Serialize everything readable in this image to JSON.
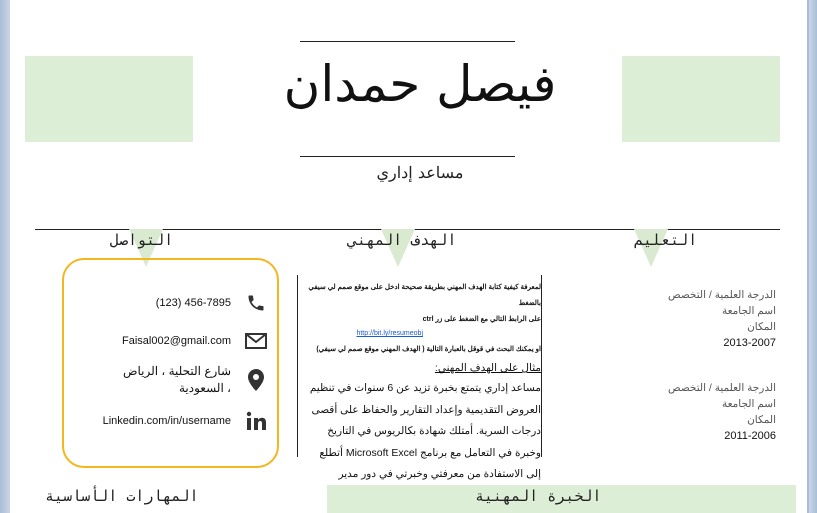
{
  "resume": {
    "name": "فيصل حمدان",
    "job_title": "مساعد إداري",
    "sections": {
      "contact": "التواصل",
      "objective": "الهدف المهني",
      "education": "التعليم",
      "skills": "المهارات الأساسية",
      "experience": "الخبرة المهنية"
    },
    "contact": {
      "phone": "(123) 456-7895",
      "email": "Faisal002@gmail.com",
      "address": "شارع التحلية ، الرياض ، السعودية",
      "linkedin": "Linkedin.com/in/username"
    },
    "objective": {
      "tip_line1": "لمعرفة كيفية كتابة الهدف المهني بطريقة صحيحة ادخل على موقع صمم لي سيفي بالضغط",
      "tip_line2_pre": "على الرابط التالي مع الضغط على زر ctrl",
      "tip_link": "http://bit.ly/resumeobj",
      "tip_line3": "او يمكنك البحث في قوقل بالعبارة التالية ( الهدف المهني موقع صمم لي سيفي)",
      "example_heading": "مثال على الهدف المهني:",
      "example_body": "مساعد إداري يتمتع بخبرة تزيد عن 6 سنوات في تنظيم العروض التقديمية وإعداد التقارير والحفاظ على أقصى درجات السرية. أمتلك شهادة بكالريوس في التاريخ وخبرة في التعامل مع برنامج Microsoft Excel أتطلع إلى الاستفادة من معرفتي وخبرتي في دور مدير المشروع."
    },
    "education": [
      {
        "degree": "الدرجة العلمية / التخصص",
        "university": "اسم الجامعة",
        "place": "المكان",
        "years": "2013-2007"
      },
      {
        "degree": "الدرجة العلمية / التخصص",
        "university": "اسم الجامعة",
        "place": "المكان",
        "years": "2011-2006"
      }
    ],
    "icons": [
      "phone-icon",
      "email-icon",
      "location-icon",
      "linkedin-icon"
    ],
    "colors": {
      "accent_green": "#ddeed6",
      "contact_border": "#f3b61f",
      "link": "#1a5bd6"
    }
  }
}
